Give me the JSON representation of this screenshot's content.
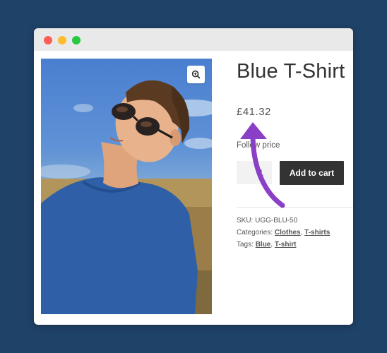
{
  "window": {
    "controls": [
      "close",
      "minimize",
      "maximize"
    ]
  },
  "product": {
    "title": "Blue T-Shirt",
    "price": "£41.32",
    "follow_price_label": "Follow price",
    "quantity": "1",
    "add_to_cart_label": "Add to cart",
    "image_icon": "zoom-in-icon"
  },
  "meta": {
    "sku_label": "SKU:",
    "sku_value": "UGG-BLU-50",
    "categories_label": "Categories:",
    "categories": [
      "Clothes",
      "T-shirts"
    ],
    "tags_label": "Tags:",
    "tags": [
      "Blue",
      "T-shirt"
    ],
    "separator": ", "
  },
  "annotation": {
    "arrow_color": "#8a3fc7",
    "icon": "curved-arrow-icon"
  },
  "colors": {
    "background": "#1f4268",
    "button": "#333333"
  }
}
